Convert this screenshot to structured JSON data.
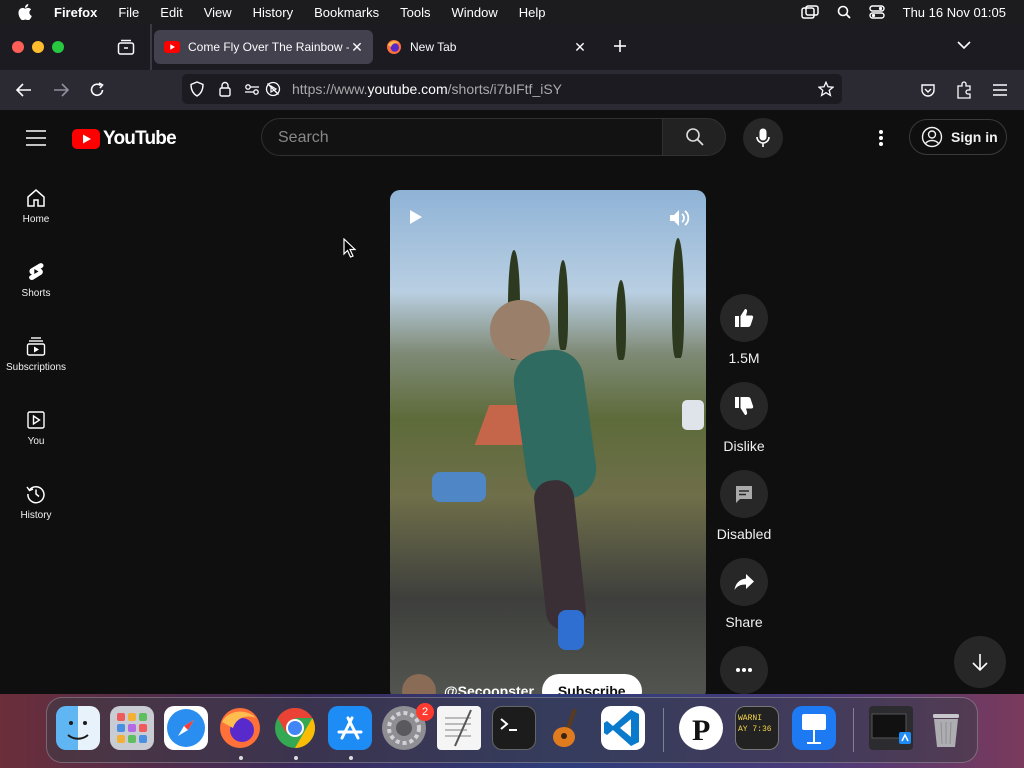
{
  "menubar": {
    "app_name": "Firefox",
    "menus": [
      "File",
      "Edit",
      "View",
      "History",
      "Bookmarks",
      "Tools",
      "Window",
      "Help"
    ],
    "clock": "Thu 16 Nov  01:05"
  },
  "browser": {
    "tabs": [
      {
        "title": "Come Fly Over The Rainbow - YouTube",
        "active": true
      },
      {
        "title": "New Tab",
        "active": false
      }
    ],
    "url": {
      "prefix": "https://www.",
      "host": "youtube.com",
      "path": "/shorts/i7bIFtf_iSY"
    }
  },
  "youtube": {
    "logo_text": "YouTube",
    "search_placeholder": "Search",
    "sign_in": "Sign in",
    "sidebar": [
      {
        "label": "Home",
        "icon": "home-icon"
      },
      {
        "label": "Shorts",
        "icon": "shorts-icon"
      },
      {
        "label": "Subscriptions",
        "icon": "subscriptions-icon"
      },
      {
        "label": "You",
        "icon": "you-icon"
      },
      {
        "label": "History",
        "icon": "history-icon"
      }
    ],
    "short": {
      "channel": "@Secoopster",
      "subscribe": "Subscribe",
      "likes": "1.5M",
      "dislike": "Dislike",
      "comments": "Disabled",
      "share": "Share"
    }
  },
  "dock": {
    "apps": [
      "Finder",
      "Launchpad",
      "Safari",
      "Firefox",
      "Chrome",
      "App Store",
      "System Settings",
      "TextEdit",
      "Terminal",
      "GarageBand",
      "Visual Studio Code",
      "PDF Viewer",
      "Console",
      "Keynote",
      "Downloads",
      "Trash"
    ],
    "settings_badge": "2",
    "console_text": "WARNI\nAY 7:36"
  },
  "colors": {
    "youtube_red": "#ff0000",
    "background": "#0f0f0f",
    "tab_active": "#42414d"
  }
}
